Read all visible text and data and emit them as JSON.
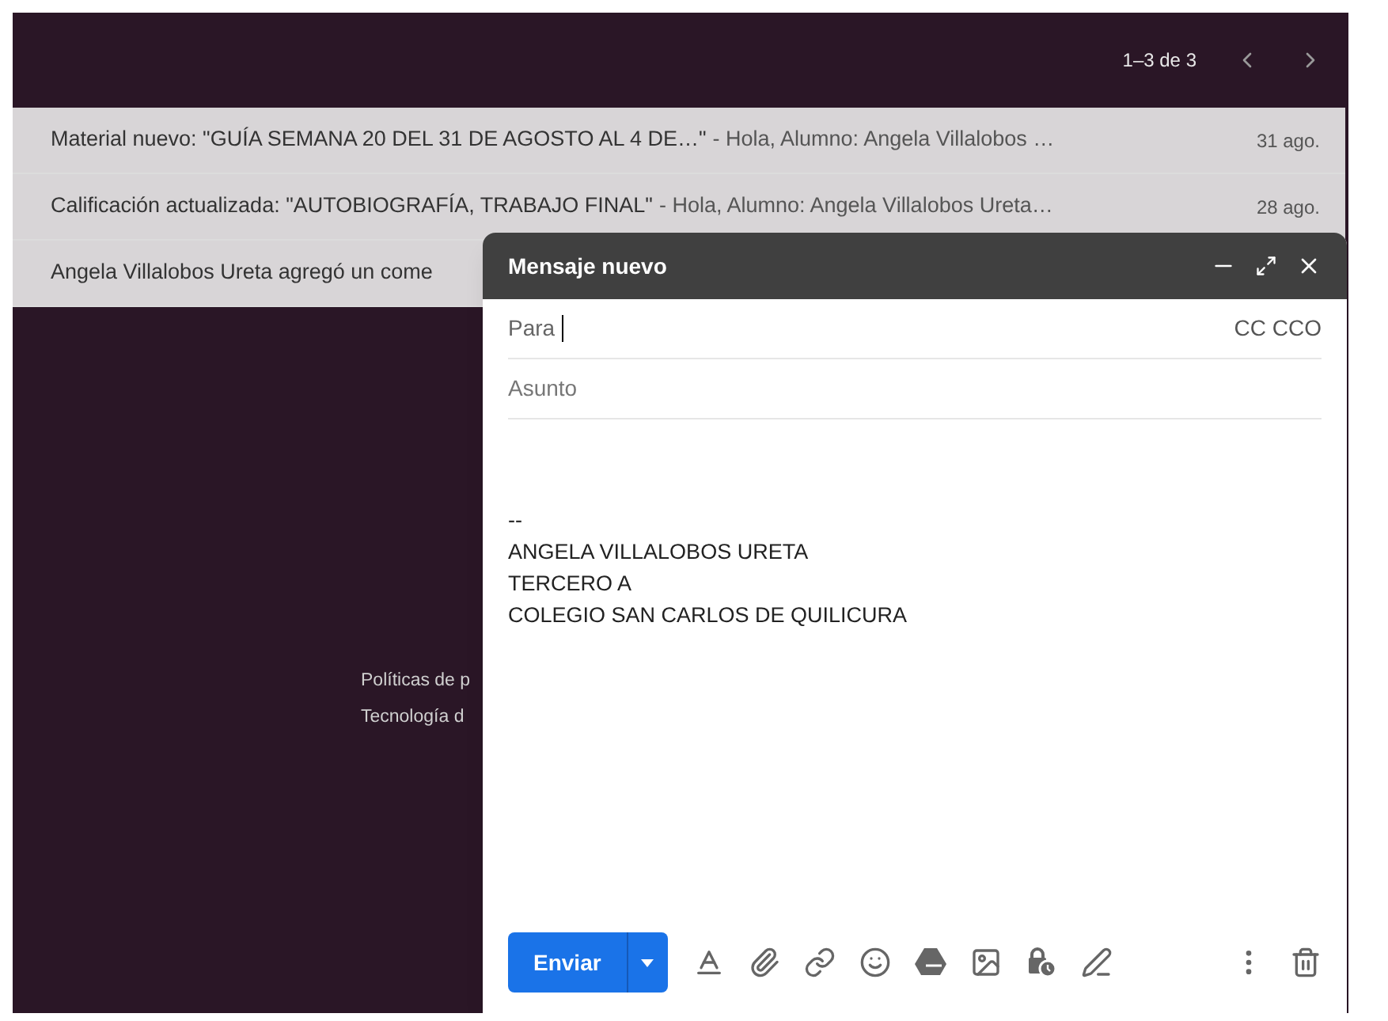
{
  "pagination": {
    "range": "1–3 de 3"
  },
  "emails": [
    {
      "subject": "Material nuevo: \"GUÍA SEMANA 20 DEL 31 DE AGOSTO AL 4 DE…\"",
      "snippet": "- Hola, Alumno: Angela Villalobos …",
      "date": "31 ago."
    },
    {
      "subject": "Calificación actualizada: \"AUTOBIOGRAFÍA, TRABAJO FINAL\"",
      "snippet": "- Hola, Alumno: Angela Villalobos Ureta…",
      "date": "28 ago."
    },
    {
      "subject": "Angela Villalobos Ureta agregó un come"
    }
  ],
  "footer_links": [
    "Políticas de p",
    "Tecnología d"
  ],
  "compose": {
    "title": "Mensaje nuevo",
    "to_label": "Para",
    "cc_label": "CC CCO",
    "subject_placeholder": "Asunto",
    "body_lines": [
      "--",
      "ANGELA VILLALOBOS URETA",
      "TERCERO A",
      "COLEGIO SAN CARLOS DE QUILICURA"
    ],
    "send": "Enviar"
  }
}
